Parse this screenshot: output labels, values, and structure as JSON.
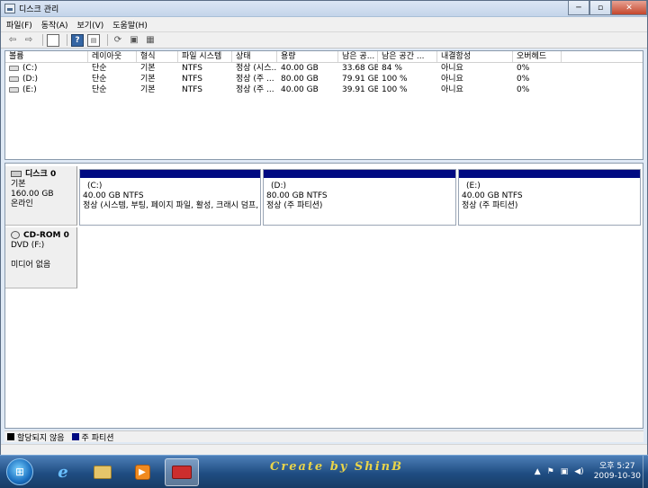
{
  "window": {
    "title": "디스크 관리"
  },
  "menu": [
    "파일(F)",
    "동작(A)",
    "보기(V)",
    "도움말(H)"
  ],
  "volume_list": {
    "columns": [
      "볼륨",
      "레이아웃",
      "형식",
      "파일 시스템",
      "상태",
      "용량",
      "남은 공...",
      "남은 공간 ...",
      "내결함성",
      "오버헤드"
    ],
    "rows": [
      [
        "(C:)",
        "단순",
        "기본",
        "NTFS",
        "정상 (시스...",
        "40.00 GB",
        "33.68 GB",
        "84 %",
        "아니요",
        "0%"
      ],
      [
        "(D:)",
        "단순",
        "기본",
        "NTFS",
        "정상 (주 ...",
        "80.00 GB",
        "79.91 GB",
        "100 %",
        "아니요",
        "0%"
      ],
      [
        "(E:)",
        "단순",
        "기본",
        "NTFS",
        "정상 (주 ...",
        "40.00 GB",
        "39.91 GB",
        "100 %",
        "아니요",
        "0%"
      ]
    ]
  },
  "disks": [
    {
      "name": "디스크 0",
      "type": "기본",
      "size": "160.00 GB",
      "state": "온라인",
      "partitions": [
        {
          "name": "(C:)",
          "size": "40.00 GB NTFS",
          "status": "정상 (시스템, 부팅, 페이지 파일, 활성, 크래시 덤프,"
        },
        {
          "name": "(D:)",
          "size": "80.00 GB NTFS",
          "status": "정상 (주 파티션)"
        },
        {
          "name": "(E:)",
          "size": "40.00 GB NTFS",
          "status": "정상 (주 파티션)"
        }
      ]
    },
    {
      "name": "CD-ROM 0",
      "type": "DVD (F:)",
      "state": "미디어 없음"
    }
  ],
  "legend": [
    {
      "label": "할당되지 않음",
      "color": "#000000"
    },
    {
      "label": "주 파티션",
      "color": "#000a82"
    }
  ],
  "taskbar": {
    "watermark": "Create by ShinB",
    "time_period": "오후 5:27",
    "date": "2009-10-30"
  },
  "icons": {
    "back": "arrow-left-icon",
    "forward": "arrow-right-icon",
    "help": "help-icon",
    "refresh": "refresh-icon",
    "properties": "properties-icon",
    "disk": "hard-disk-icon",
    "cdrom": "cdrom-icon"
  }
}
